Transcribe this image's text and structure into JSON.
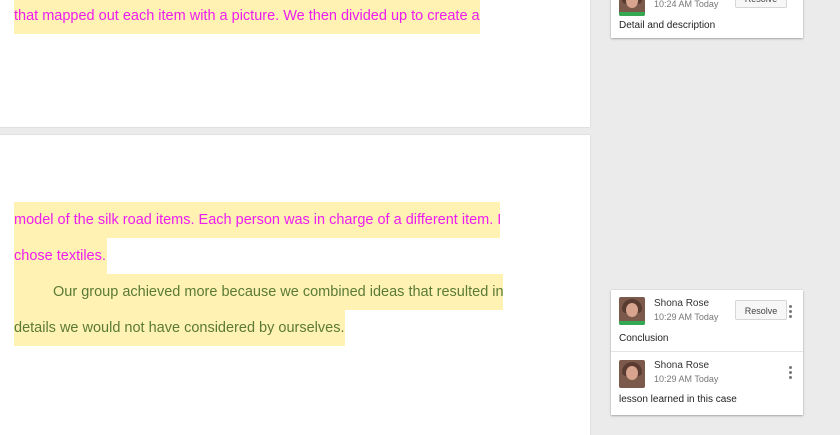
{
  "document": {
    "page1_lines": [
      "that mapped out each item with a picture. We then divided up to create a"
    ],
    "page2_lines": [
      "model of the silk road items. Each person was in charge of a different item. I",
      "chose textiles.",
      "Our group achieved more because we combined ideas that resulted in",
      "details we would not have considered by ourselves."
    ]
  },
  "comments": {
    "top_card": {
      "time": "10:24 AM Today",
      "resolve_label": "Resolve",
      "text": "Detail and description"
    },
    "thread": {
      "first": {
        "author": "Shona Rose",
        "time": "10:29 AM Today",
        "resolve_label": "Resolve",
        "text": "Conclusion"
      },
      "reply": {
        "author": "Shona Rose",
        "time": "10:29 AM Today",
        "text": "lesson learned in this case"
      }
    }
  },
  "colors": {
    "highlight": "#fff2b3",
    "pink_text": "#ee1cf0",
    "green_text": "#5a7a35",
    "avatar_status": "#35a853"
  }
}
